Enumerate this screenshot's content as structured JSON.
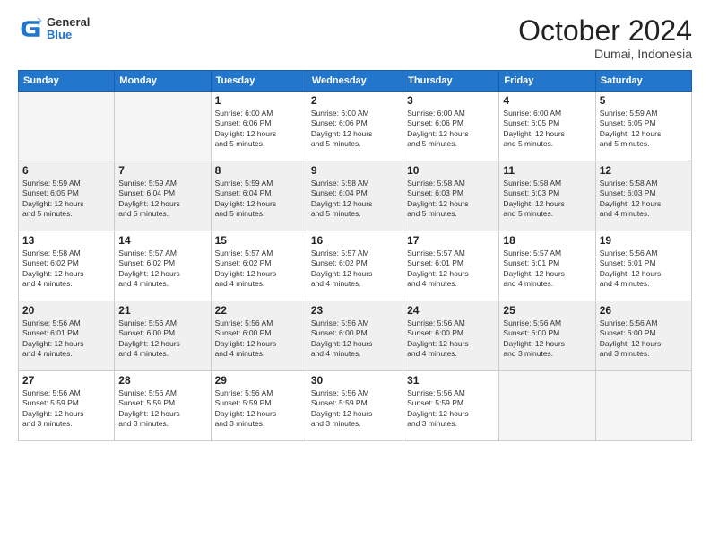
{
  "logo": {
    "general": "General",
    "blue": "Blue"
  },
  "header": {
    "month": "October 2024",
    "location": "Dumai, Indonesia"
  },
  "weekdays": [
    "Sunday",
    "Monday",
    "Tuesday",
    "Wednesday",
    "Thursday",
    "Friday",
    "Saturday"
  ],
  "rows": [
    [
      {
        "day": "",
        "lines": []
      },
      {
        "day": "",
        "lines": []
      },
      {
        "day": "1",
        "lines": [
          "Sunrise: 6:00 AM",
          "Sunset: 6:06 PM",
          "Daylight: 12 hours",
          "and 5 minutes."
        ]
      },
      {
        "day": "2",
        "lines": [
          "Sunrise: 6:00 AM",
          "Sunset: 6:06 PM",
          "Daylight: 12 hours",
          "and 5 minutes."
        ]
      },
      {
        "day": "3",
        "lines": [
          "Sunrise: 6:00 AM",
          "Sunset: 6:06 PM",
          "Daylight: 12 hours",
          "and 5 minutes."
        ]
      },
      {
        "day": "4",
        "lines": [
          "Sunrise: 6:00 AM",
          "Sunset: 6:05 PM",
          "Daylight: 12 hours",
          "and 5 minutes."
        ]
      },
      {
        "day": "5",
        "lines": [
          "Sunrise: 5:59 AM",
          "Sunset: 6:05 PM",
          "Daylight: 12 hours",
          "and 5 minutes."
        ]
      }
    ],
    [
      {
        "day": "6",
        "lines": [
          "Sunrise: 5:59 AM",
          "Sunset: 6:05 PM",
          "Daylight: 12 hours",
          "and 5 minutes."
        ]
      },
      {
        "day": "7",
        "lines": [
          "Sunrise: 5:59 AM",
          "Sunset: 6:04 PM",
          "Daylight: 12 hours",
          "and 5 minutes."
        ]
      },
      {
        "day": "8",
        "lines": [
          "Sunrise: 5:59 AM",
          "Sunset: 6:04 PM",
          "Daylight: 12 hours",
          "and 5 minutes."
        ]
      },
      {
        "day": "9",
        "lines": [
          "Sunrise: 5:58 AM",
          "Sunset: 6:04 PM",
          "Daylight: 12 hours",
          "and 5 minutes."
        ]
      },
      {
        "day": "10",
        "lines": [
          "Sunrise: 5:58 AM",
          "Sunset: 6:03 PM",
          "Daylight: 12 hours",
          "and 5 minutes."
        ]
      },
      {
        "day": "11",
        "lines": [
          "Sunrise: 5:58 AM",
          "Sunset: 6:03 PM",
          "Daylight: 12 hours",
          "and 5 minutes."
        ]
      },
      {
        "day": "12",
        "lines": [
          "Sunrise: 5:58 AM",
          "Sunset: 6:03 PM",
          "Daylight: 12 hours",
          "and 4 minutes."
        ]
      }
    ],
    [
      {
        "day": "13",
        "lines": [
          "Sunrise: 5:58 AM",
          "Sunset: 6:02 PM",
          "Daylight: 12 hours",
          "and 4 minutes."
        ]
      },
      {
        "day": "14",
        "lines": [
          "Sunrise: 5:57 AM",
          "Sunset: 6:02 PM",
          "Daylight: 12 hours",
          "and 4 minutes."
        ]
      },
      {
        "day": "15",
        "lines": [
          "Sunrise: 5:57 AM",
          "Sunset: 6:02 PM",
          "Daylight: 12 hours",
          "and 4 minutes."
        ]
      },
      {
        "day": "16",
        "lines": [
          "Sunrise: 5:57 AM",
          "Sunset: 6:02 PM",
          "Daylight: 12 hours",
          "and 4 minutes."
        ]
      },
      {
        "day": "17",
        "lines": [
          "Sunrise: 5:57 AM",
          "Sunset: 6:01 PM",
          "Daylight: 12 hours",
          "and 4 minutes."
        ]
      },
      {
        "day": "18",
        "lines": [
          "Sunrise: 5:57 AM",
          "Sunset: 6:01 PM",
          "Daylight: 12 hours",
          "and 4 minutes."
        ]
      },
      {
        "day": "19",
        "lines": [
          "Sunrise: 5:56 AM",
          "Sunset: 6:01 PM",
          "Daylight: 12 hours",
          "and 4 minutes."
        ]
      }
    ],
    [
      {
        "day": "20",
        "lines": [
          "Sunrise: 5:56 AM",
          "Sunset: 6:01 PM",
          "Daylight: 12 hours",
          "and 4 minutes."
        ]
      },
      {
        "day": "21",
        "lines": [
          "Sunrise: 5:56 AM",
          "Sunset: 6:00 PM",
          "Daylight: 12 hours",
          "and 4 minutes."
        ]
      },
      {
        "day": "22",
        "lines": [
          "Sunrise: 5:56 AM",
          "Sunset: 6:00 PM",
          "Daylight: 12 hours",
          "and 4 minutes."
        ]
      },
      {
        "day": "23",
        "lines": [
          "Sunrise: 5:56 AM",
          "Sunset: 6:00 PM",
          "Daylight: 12 hours",
          "and 4 minutes."
        ]
      },
      {
        "day": "24",
        "lines": [
          "Sunrise: 5:56 AM",
          "Sunset: 6:00 PM",
          "Daylight: 12 hours",
          "and 4 minutes."
        ]
      },
      {
        "day": "25",
        "lines": [
          "Sunrise: 5:56 AM",
          "Sunset: 6:00 PM",
          "Daylight: 12 hours",
          "and 3 minutes."
        ]
      },
      {
        "day": "26",
        "lines": [
          "Sunrise: 5:56 AM",
          "Sunset: 6:00 PM",
          "Daylight: 12 hours",
          "and 3 minutes."
        ]
      }
    ],
    [
      {
        "day": "27",
        "lines": [
          "Sunrise: 5:56 AM",
          "Sunset: 5:59 PM",
          "Daylight: 12 hours",
          "and 3 minutes."
        ]
      },
      {
        "day": "28",
        "lines": [
          "Sunrise: 5:56 AM",
          "Sunset: 5:59 PM",
          "Daylight: 12 hours",
          "and 3 minutes."
        ]
      },
      {
        "day": "29",
        "lines": [
          "Sunrise: 5:56 AM",
          "Sunset: 5:59 PM",
          "Daylight: 12 hours",
          "and 3 minutes."
        ]
      },
      {
        "day": "30",
        "lines": [
          "Sunrise: 5:56 AM",
          "Sunset: 5:59 PM",
          "Daylight: 12 hours",
          "and 3 minutes."
        ]
      },
      {
        "day": "31",
        "lines": [
          "Sunrise: 5:56 AM",
          "Sunset: 5:59 PM",
          "Daylight: 12 hours",
          "and 3 minutes."
        ]
      },
      {
        "day": "",
        "lines": []
      },
      {
        "day": "",
        "lines": []
      }
    ]
  ]
}
